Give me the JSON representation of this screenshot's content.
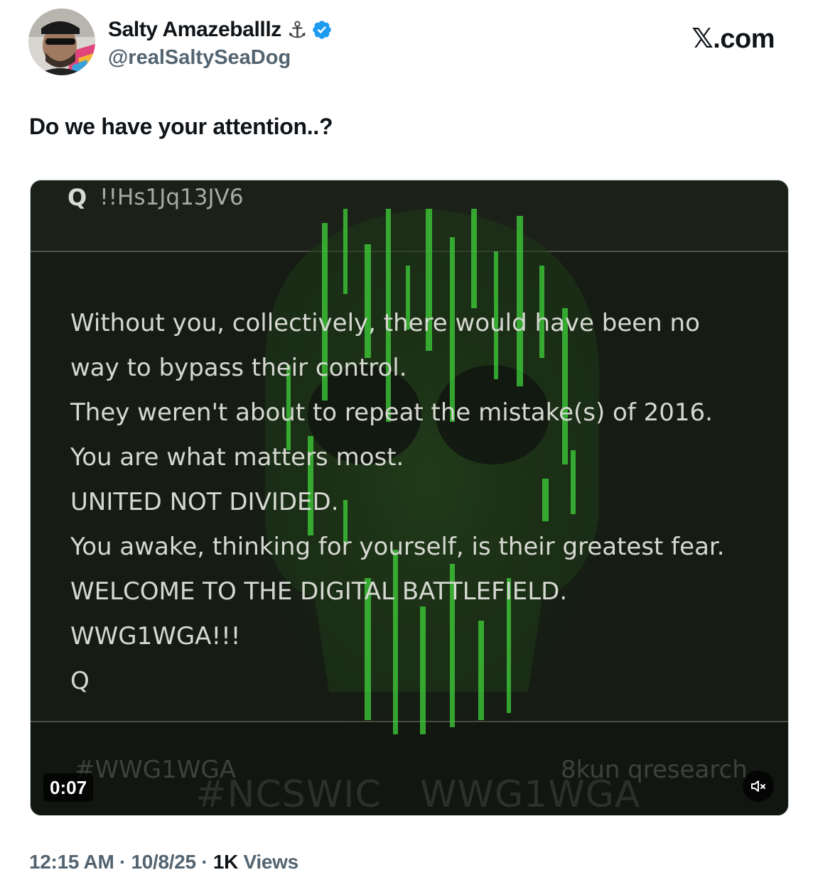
{
  "header": {
    "display_name": "Salty Amazeballlz",
    "name_emoji": "⚓",
    "handle": "@realSaltySeaDog",
    "brand": "𝕏.com"
  },
  "tweet": {
    "text": "Do we have your attention..?"
  },
  "media": {
    "post_marker": "Q",
    "tripcode": "!!Hs1Jq13JV6",
    "lines": [
      "Without you, collectively, there would have been no",
      "way to bypass their control.",
      "They weren't about to repeat the mistake(s) of 2016.",
      "You are what matters most.",
      "UNITED NOT DIVIDED.",
      "You awake, thinking for yourself, is their greatest fear.",
      "WELCOME TO THE DIGITAL BATTLEFIELD.",
      "WWG1WGA!!!",
      "Q"
    ],
    "watermark_hashtag": "#WWG1WGA",
    "watermark_ncswic": "#NCSWIC",
    "watermark_wwg": "WWG1WGA",
    "watermark_source": "8kun qresearch",
    "duration": "0:07"
  },
  "meta": {
    "time": "12:15 AM",
    "separator": "·",
    "date": "10/8/25",
    "views_count": "1K",
    "views_label": "Views"
  },
  "colors": {
    "verified_blue": "#1d9bf0",
    "matrix_green": "#3fd23a",
    "meta_gray": "#536471"
  },
  "icons": {
    "verified": "verified-badge-icon",
    "mute": "speaker-muted-icon"
  }
}
